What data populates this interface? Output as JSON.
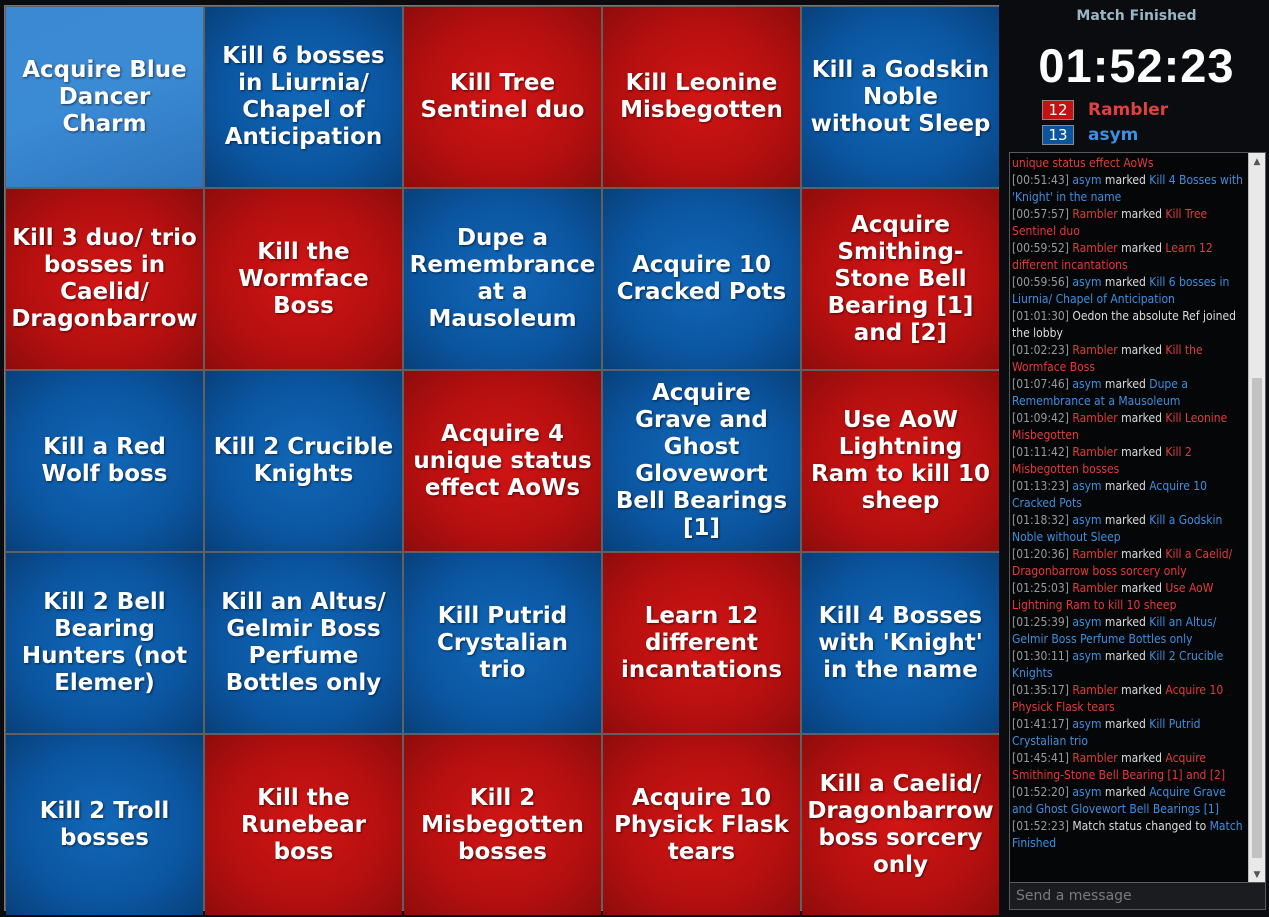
{
  "board": {
    "cells": [
      {
        "text": "Acquire Blue Dancer Charm",
        "color": "lightblue"
      },
      {
        "text": "Kill 6 bosses in Liurnia/ Chapel of Anticipation",
        "color": "blue"
      },
      {
        "text": "Kill Tree Sentinel duo",
        "color": "red"
      },
      {
        "text": "Kill Leonine Misbegotten",
        "color": "red"
      },
      {
        "text": "Kill a Godskin Noble without Sleep",
        "color": "blue"
      },
      {
        "text": "Kill 3 duo/ trio bosses in Caelid/ Dragonbarrow",
        "color": "red"
      },
      {
        "text": "Kill the Wormface Boss",
        "color": "red"
      },
      {
        "text": "Dupe a Remembrance at a Mausoleum",
        "color": "blue"
      },
      {
        "text": "Acquire 10 Cracked Pots",
        "color": "blue"
      },
      {
        "text": "Acquire Smithing-Stone Bell Bearing [1] and [2]",
        "color": "red"
      },
      {
        "text": "Kill a Red Wolf boss",
        "color": "blue"
      },
      {
        "text": "Kill 2 Crucible Knights",
        "color": "blue"
      },
      {
        "text": "Acquire 4 unique status effect AoWs",
        "color": "red"
      },
      {
        "text": "Acquire Grave and Ghost Glovewort Bell Bearings [1]",
        "color": "blue"
      },
      {
        "text": "Use AoW Lightning Ram to kill 10 sheep",
        "color": "red"
      },
      {
        "text": "Kill 2 Bell Bearing Hunters (not Elemer)",
        "color": "blue"
      },
      {
        "text": "Kill an Altus/ Gelmir Boss Perfume Bottles only",
        "color": "blue"
      },
      {
        "text": "Kill Putrid Crystalian trio",
        "color": "blue"
      },
      {
        "text": "Learn 12 different incantations",
        "color": "red"
      },
      {
        "text": "Kill 4 Bosses with 'Knight' in the name",
        "color": "blue"
      },
      {
        "text": "Kill 2 Troll bosses",
        "color": "blue"
      },
      {
        "text": "Kill the Runebear boss",
        "color": "red"
      },
      {
        "text": "Kill 2 Misbegotten bosses",
        "color": "red"
      },
      {
        "text": "Acquire 10 Physick Flask tears",
        "color": "red"
      },
      {
        "text": "Kill a Caelid/ Dragonbarrow boss sorcery only",
        "color": "red"
      }
    ]
  },
  "colors": {
    "red": "#c41111",
    "blue": "#0b55a0",
    "lightblue": "#3b89d2"
  },
  "side": {
    "status": "Match Finished",
    "timer": "01:52:23",
    "players": [
      {
        "score": "12",
        "name": "Rambler",
        "team": "red"
      },
      {
        "score": "13",
        "name": "asym",
        "team": "blue"
      }
    ],
    "message_placeholder": "Send a message"
  },
  "log": [
    {
      "parts": [
        [
          "r",
          "unique status effect AoWs"
        ]
      ]
    },
    {
      "parts": [
        [
          "ts",
          "[00:51:43] "
        ],
        [
          "b",
          "asym"
        ],
        [
          "plain",
          " marked "
        ],
        [
          "b",
          "Kill 4 Bosses with 'Knight' in the name"
        ]
      ]
    },
    {
      "parts": [
        [
          "ts",
          "[00:57:57] "
        ],
        [
          "r",
          "Rambler"
        ],
        [
          "plain",
          " marked "
        ],
        [
          "r",
          "Kill Tree Sentinel duo"
        ]
      ]
    },
    {
      "parts": [
        [
          "ts",
          "[00:59:52] "
        ],
        [
          "r",
          "Rambler"
        ],
        [
          "plain",
          " marked "
        ],
        [
          "r",
          "Learn 12 different incantations"
        ]
      ]
    },
    {
      "parts": [
        [
          "ts",
          "[00:59:56] "
        ],
        [
          "b",
          "asym"
        ],
        [
          "plain",
          " marked "
        ],
        [
          "b",
          "Kill 6 bosses in Liurnia/ Chapel of Anticipation"
        ]
      ]
    },
    {
      "parts": [
        [
          "ts",
          "[01:01:30] "
        ],
        [
          "plain",
          "Oedon the absolute Ref joined the lobby"
        ]
      ]
    },
    {
      "parts": [
        [
          "ts",
          "[01:02:23] "
        ],
        [
          "r",
          "Rambler"
        ],
        [
          "plain",
          " marked "
        ],
        [
          "r",
          "Kill the Wormface Boss"
        ]
      ]
    },
    {
      "parts": [
        [
          "ts",
          "[01:07:46] "
        ],
        [
          "b",
          "asym"
        ],
        [
          "plain",
          " marked "
        ],
        [
          "b",
          "Dupe a Remembrance at a Mausoleum"
        ]
      ]
    },
    {
      "parts": [
        [
          "ts",
          "[01:09:42] "
        ],
        [
          "r",
          "Rambler"
        ],
        [
          "plain",
          " marked "
        ],
        [
          "r",
          "Kill Leonine Misbegotten"
        ]
      ]
    },
    {
      "parts": [
        [
          "ts",
          "[01:11:42] "
        ],
        [
          "r",
          "Rambler"
        ],
        [
          "plain",
          " marked "
        ],
        [
          "r",
          "Kill 2 Misbegotten bosses"
        ]
      ]
    },
    {
      "parts": [
        [
          "ts",
          "[01:13:23] "
        ],
        [
          "b",
          "asym"
        ],
        [
          "plain",
          " marked "
        ],
        [
          "b",
          "Acquire 10 Cracked Pots"
        ]
      ]
    },
    {
      "parts": [
        [
          "ts",
          "[01:18:32] "
        ],
        [
          "b",
          "asym"
        ],
        [
          "plain",
          " marked "
        ],
        [
          "b",
          "Kill a Godskin Noble without Sleep"
        ]
      ]
    },
    {
      "parts": [
        [
          "ts",
          "[01:20:36] "
        ],
        [
          "r",
          "Rambler"
        ],
        [
          "plain",
          " marked "
        ],
        [
          "r",
          "Kill a Caelid/ Dragonbarrow boss sorcery only"
        ]
      ]
    },
    {
      "parts": [
        [
          "ts",
          "[01:25:03] "
        ],
        [
          "r",
          "Rambler"
        ],
        [
          "plain",
          " marked "
        ],
        [
          "r",
          "Use AoW Lightning Ram to kill 10 sheep"
        ]
      ]
    },
    {
      "parts": [
        [
          "ts",
          "[01:25:39] "
        ],
        [
          "b",
          "asym"
        ],
        [
          "plain",
          " marked "
        ],
        [
          "b",
          "Kill an Altus/ Gelmir Boss Perfume Bottles only"
        ]
      ]
    },
    {
      "parts": [
        [
          "ts",
          "[01:30:11] "
        ],
        [
          "b",
          "asym"
        ],
        [
          "plain",
          " marked "
        ],
        [
          "b",
          "Kill 2 Crucible Knights"
        ]
      ]
    },
    {
      "parts": [
        [
          "ts",
          "[01:35:17] "
        ],
        [
          "r",
          "Rambler"
        ],
        [
          "plain",
          " marked "
        ],
        [
          "r",
          "Acquire 10 Physick Flask tears"
        ]
      ]
    },
    {
      "parts": [
        [
          "ts",
          "[01:41:17] "
        ],
        [
          "b",
          "asym"
        ],
        [
          "plain",
          " marked "
        ],
        [
          "b",
          "Kill Putrid Crystalian trio"
        ]
      ]
    },
    {
      "parts": [
        [
          "ts",
          "[01:45:41] "
        ],
        [
          "r",
          "Rambler"
        ],
        [
          "plain",
          " marked "
        ],
        [
          "r",
          "Acquire Smithing-Stone Bell Bearing [1] and [2]"
        ]
      ]
    },
    {
      "parts": [
        [
          "ts",
          "[01:52:20] "
        ],
        [
          "b",
          "asym"
        ],
        [
          "plain",
          " marked "
        ],
        [
          "b",
          "Acquire Grave and Ghost Glovewort Bell Bearings [1]"
        ]
      ]
    },
    {
      "parts": [
        [
          "ts",
          "[01:52:23] "
        ],
        [
          "plain",
          "Match status changed to "
        ],
        [
          "b",
          "Match Finished"
        ]
      ]
    }
  ],
  "scrollbar": {
    "up_icon": "▲",
    "down_icon": "▼"
  }
}
